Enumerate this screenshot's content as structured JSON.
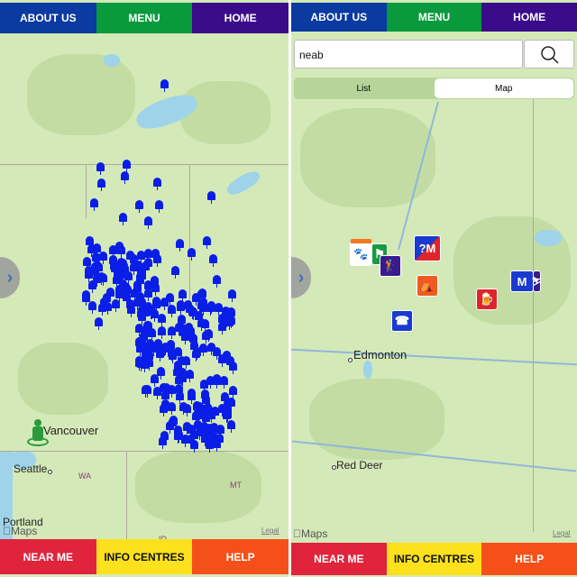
{
  "left_screen": {
    "top_nav": {
      "about": "ABOUT US",
      "menu": "MENU",
      "home": "HOME"
    },
    "map_labels": {
      "vancouver": "Vancouver",
      "seattle": "Seattle",
      "wa": "WA",
      "mt": "MT",
      "portland": "Portland",
      "id": "ID",
      "maps": "Maps",
      "legal": "Legal"
    },
    "bottom_nav": {
      "near_me": "NEAR ME",
      "info_centres": "INFO CENTRES",
      "help": "HELP"
    }
  },
  "right_screen": {
    "top_nav": {
      "about": "ABOUT US",
      "menu": "MENU",
      "home": "HOME"
    },
    "search": {
      "value": "neab"
    },
    "view_toggle": {
      "list": "List",
      "map": "Map",
      "selected": "Map"
    },
    "map_labels": {
      "edmonton": "Edmonton",
      "red_deer": "Red Deer",
      "maps": "Maps",
      "legal": "Legal"
    },
    "pois": [
      "wildlife-icon",
      "flag-icon",
      "golf-icon",
      "museum-info-icon",
      "campground-icon",
      "beer-icon",
      "museum-icon",
      "ski-icon",
      "phone-icon"
    ],
    "bottom_nav": {
      "near_me": "NEAR ME",
      "info_centres": "INFO CENTRES",
      "help": "HELP"
    }
  },
  "colors": {
    "about": "#0b3aa0",
    "menu": "#089a3c",
    "home": "#3a0c8c",
    "near_me": "#e0243c",
    "info_centres": "#fde11c",
    "help": "#f5501a",
    "pin": "#0a1ee8"
  }
}
